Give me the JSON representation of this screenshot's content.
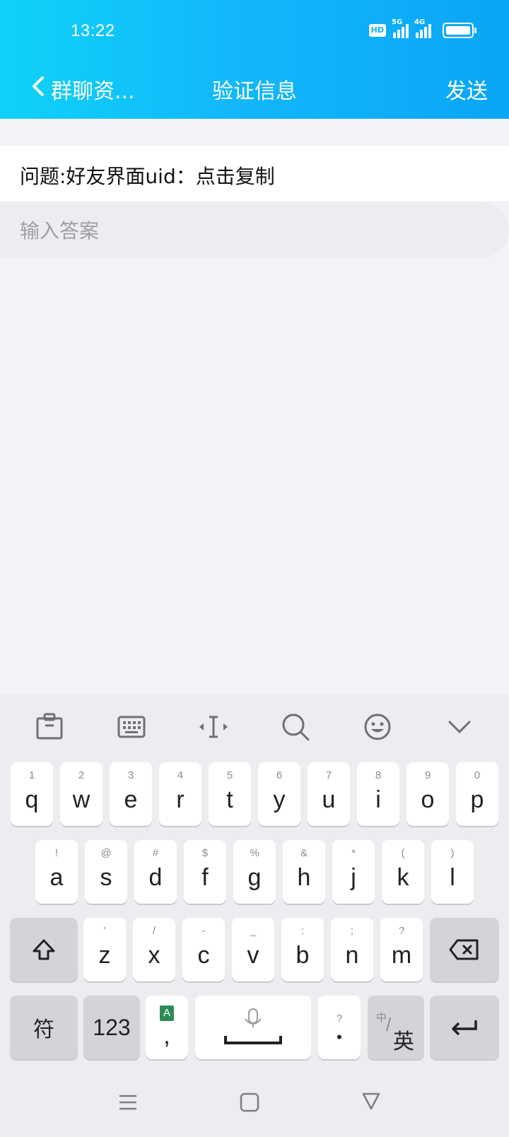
{
  "status": {
    "time": "13:22",
    "hd": "HD",
    "net1": "5G",
    "net2": "4G"
  },
  "header": {
    "back_label": "群聊资...",
    "title": "验证信息",
    "send_label": "发送"
  },
  "question": {
    "text": "问题:好友界面uid：点击复制"
  },
  "answer": {
    "placeholder": "输入答案",
    "value": ""
  },
  "keyboard": {
    "row1": [
      {
        "hint": "1",
        "char": "q"
      },
      {
        "hint": "2",
        "char": "w"
      },
      {
        "hint": "3",
        "char": "e"
      },
      {
        "hint": "4",
        "char": "r"
      },
      {
        "hint": "5",
        "char": "t"
      },
      {
        "hint": "6",
        "char": "y"
      },
      {
        "hint": "7",
        "char": "u"
      },
      {
        "hint": "8",
        "char": "i"
      },
      {
        "hint": "9",
        "char": "o"
      },
      {
        "hint": "0",
        "char": "p"
      }
    ],
    "row2": [
      {
        "hint": "!",
        "char": "a"
      },
      {
        "hint": "@",
        "char": "s"
      },
      {
        "hint": "#",
        "char": "d"
      },
      {
        "hint": "$",
        "char": "f"
      },
      {
        "hint": "%",
        "char": "g"
      },
      {
        "hint": "&",
        "char": "h"
      },
      {
        "hint": "*",
        "char": "j"
      },
      {
        "hint": "(",
        "char": "k"
      },
      {
        "hint": ")",
        "char": "l"
      }
    ],
    "row3": [
      {
        "hint": "'",
        "char": "z"
      },
      {
        "hint": "/",
        "char": "x"
      },
      {
        "hint": "-",
        "char": "c"
      },
      {
        "hint": "_",
        "char": "v"
      },
      {
        "hint": ":",
        "char": "b"
      },
      {
        "hint": ";",
        "char": "n"
      },
      {
        "hint": "?",
        "char": "m"
      }
    ],
    "symbols_label": "符",
    "numbers_label": "123",
    "comma_label": ",",
    "comma_badge": "A",
    "period_hint": "?",
    "period_label": "•",
    "lang_small": "中",
    "lang_slash": "/",
    "lang_main": "英"
  },
  "colors": {
    "header_start": "#0fd2f8",
    "header_end": "#0aa5f6",
    "keyboard_bg": "#ecedf0"
  }
}
